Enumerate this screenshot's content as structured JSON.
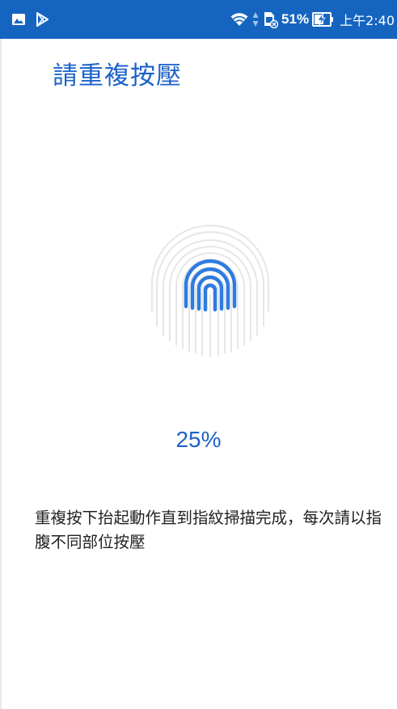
{
  "status_bar": {
    "battery_percent": "51%",
    "time": "上午2:40",
    "background_color": "#1565c0",
    "left_icons": [
      "image-notification-icon",
      "play-store-icon"
    ],
    "right_icons": [
      "wifi-icon",
      "data-transfer-icon",
      "sim-missing-icon",
      "battery-charging-icon"
    ]
  },
  "page": {
    "title": "請重複按壓",
    "progress_percent": "25%",
    "instruction": "重複按下抬起動作直到指紋掃描完成，每次請以指腹不同部位按壓"
  },
  "colors": {
    "accent": "#1c62c9",
    "fingerprint_highlight": "#2f7be0",
    "fingerprint_ghost": "#e6e6e6"
  },
  "progress": {
    "value": 0.25
  }
}
